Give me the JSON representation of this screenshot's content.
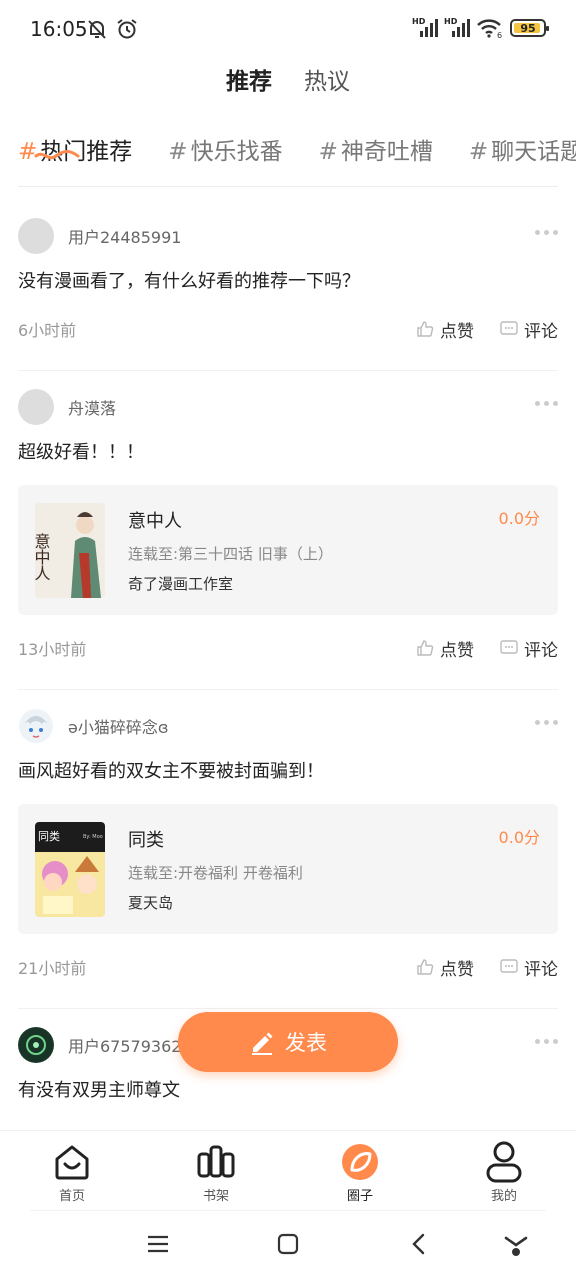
{
  "status_bar": {
    "time": "16:05",
    "battery": "95",
    "net_label_1": "HD",
    "net_label_2": "HD",
    "wifi_sub": "6",
    "icons": [
      "mute-bell-icon",
      "alarm-icon",
      "signal-icon",
      "signal-icon",
      "wifi-icon",
      "battery-icon"
    ]
  },
  "top_tabs": [
    {
      "label": "推荐",
      "active": true
    },
    {
      "label": "热议",
      "active": false
    }
  ],
  "topics": [
    {
      "hash": "#",
      "label": "热门推荐",
      "active": true
    },
    {
      "hash": "#",
      "label": "快乐找番",
      "active": false
    },
    {
      "hash": "#",
      "label": "神奇吐槽",
      "active": false
    },
    {
      "hash": "#",
      "label": "聊天话题",
      "active": false
    }
  ],
  "posts": [
    {
      "username": "用户24485991",
      "text": "没有漫画看了，有什么好看的推荐一下吗？",
      "time": "6小时前",
      "like_label": "点赞",
      "comment_label": "评论"
    },
    {
      "username": "舟漠落",
      "text": "超级好看！！！",
      "book": {
        "title": "意中人",
        "update": "连载至:第三十四话 旧事（上）",
        "author": "奇了漫画工作室",
        "score": "0.0分",
        "cover_text": "意中人"
      },
      "time": "13小时前",
      "like_label": "点赞",
      "comment_label": "评论"
    },
    {
      "username": "ə小猫碎碎念ɞ",
      "text": "画风超好看的双女主不要被封面骗到！",
      "book": {
        "title": "同类",
        "update": "连载至:开卷福利 开卷福利",
        "author": "夏天岛",
        "score": "0.0分",
        "cover_text": "同类",
        "cover_sub": "By: Moo"
      },
      "time": "21小时前",
      "like_label": "点赞",
      "comment_label": "评论"
    },
    {
      "username": "用户67579362",
      "text": "有没有双男主师尊文"
    }
  ],
  "fab": {
    "label": "发表"
  },
  "bottom_nav": [
    {
      "label": "首页",
      "icon": "home-icon"
    },
    {
      "label": "书架",
      "icon": "bookshelf-icon"
    },
    {
      "label": "圈子",
      "icon": "circle-icon",
      "active": true
    },
    {
      "label": "我的",
      "icon": "profile-icon"
    }
  ],
  "colors": {
    "accent": "#ff8a4c"
  }
}
